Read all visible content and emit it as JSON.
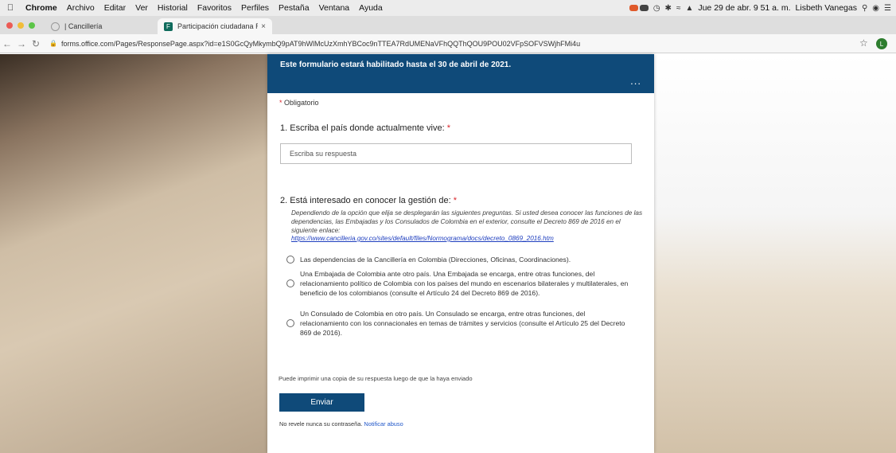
{
  "menubar": {
    "app": "Chrome",
    "items": [
      "Archivo",
      "Editar",
      "Ver",
      "Historial",
      "Favoritos",
      "Perfiles",
      "Pestaña",
      "Ventana",
      "Ayuda"
    ],
    "datetime": "Jue 29 de abr.  9 51 a. m.",
    "user": "Lisbeth Vanegas"
  },
  "tabs": [
    {
      "title": "| Cancillería",
      "close": "×"
    },
    {
      "title": "Participación ciudadana Rendi",
      "close": "×"
    }
  ],
  "toolbar": {
    "url": "forms.office.com/Pages/ResponsePage.aspx?id=e1S0GcQyMkymbQ9pAT9hWlMcUzXmhYBCoc9nTTEA7RdUMENaVFhQQThQOU9POU02VFpSOFVSWjhFMi4u",
    "profile_initial": "L"
  },
  "form": {
    "header_text": "Este formulario estará habilitado hasta el 30 de abril de 2021.",
    "more": "...",
    "required_note": "Obligatorio",
    "q1": {
      "title": "1. Escriba el país donde actualmente vive:",
      "placeholder": "Escriba su respuesta"
    },
    "q2": {
      "title": "2. Está interesado en conocer la gestión de:",
      "description": "Dependiendo de la opción que elija se desplegarán las siguientes preguntas. Si usted desea conocer las funciones de las dependencias, las Embajadas y los Consulados de Colombia en el exterior, consulte el Decreto 869 de 2016 en el siguiente enlace:",
      "link": "https://www.cancilleria.gov.co/sites/default/files/Normograma/docs/decreto_0869_2016.htm",
      "options": [
        "Las dependencias de la Cancillería en Colombia (Direcciones, Oficinas, Coordinaciones).",
        "Una Embajada de Colombia ante otro país. Una Embajada se encarga, entre otras funciones, del relacionamiento político de Colombia con los países del mundo en escenarios bilaterales y multilaterales, en beneficio de los colombianos (consulte el Artículo 24 del Decreto 869 de 2016).",
        "Un Consulado de Colombia en otro país. Un Consulado se encarga, entre otras funciones, del relacionamiento con los connacionales en temas de trámites y servicios (consulte el Artículo 25 del Decreto 869 de 2016)."
      ]
    },
    "print_note": "Puede imprimir una copia de su respuesta luego de que la haya enviado",
    "submit_label": "Enviar",
    "footer_text": "No revele nunca su contraseña.",
    "footer_link": "Notificar abuso"
  },
  "colors": {
    "brand_blue": "#0f4a79",
    "required_red": "#d9262b",
    "link_blue": "#1f3fbf"
  }
}
